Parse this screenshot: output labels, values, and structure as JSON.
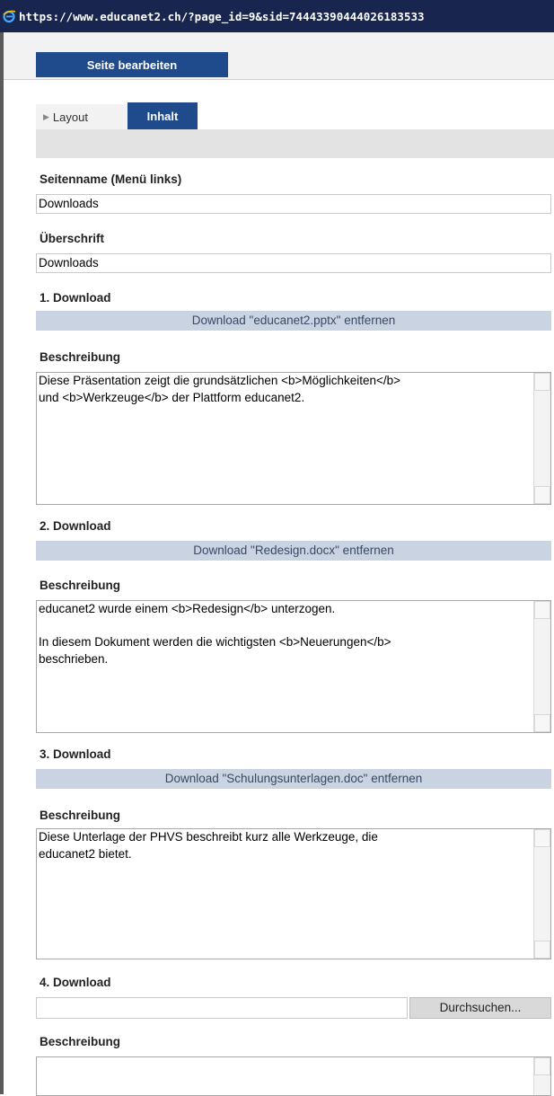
{
  "window": {
    "url": "https://www.educanet2.ch/?page_id=9&sid=74443390444026183533",
    "icon": "ie-icon"
  },
  "toolbar": {
    "edit_label": "Seite bearbeiten"
  },
  "tabs": [
    {
      "label": "Layout",
      "active": false
    },
    {
      "label": "Inhalt",
      "active": true
    }
  ],
  "form": {
    "page_name": {
      "label": "Seitenname (Menü links)",
      "value": "Downloads"
    },
    "heading": {
      "label": "Überschrift",
      "value": "Downloads"
    },
    "downloads": [
      {
        "label": "1. Download",
        "remove_label": "Download \"educanet2.pptx\" entfernen",
        "desc_label": "Beschreibung",
        "desc_value": "Diese Präsentation zeigt die grundsätzlichen <b>Möglichkeiten</b>\nund <b>Werkzeuge</b> der Plattform educanet2."
      },
      {
        "label": "2. Download",
        "remove_label": "Download \"Redesign.docx\" entfernen",
        "desc_label": "Beschreibung",
        "desc_value": "educanet2 wurde einem <b>Redesign</b> unterzogen.\n\nIn diesem Dokument werden die wichtigsten <b>Neuerungen</b>\nbeschrieben."
      },
      {
        "label": "3. Download",
        "remove_label": "Download \"Schulungsunterlagen.doc\" entfernen",
        "desc_label": "Beschreibung",
        "desc_value": "Diese Unterlage der PHVS beschreibt kurz alle Werkzeuge, die\neducanet2 bietet."
      },
      {
        "label": "4. Download",
        "browse_label": "Durchsuchen...",
        "file_value": "",
        "desc_label": "Beschreibung",
        "desc_value": ""
      }
    ]
  },
  "colors": {
    "accent": "#1f4a8c",
    "remove_bar": "#c9d3e2",
    "titlebar": "#17254f"
  }
}
